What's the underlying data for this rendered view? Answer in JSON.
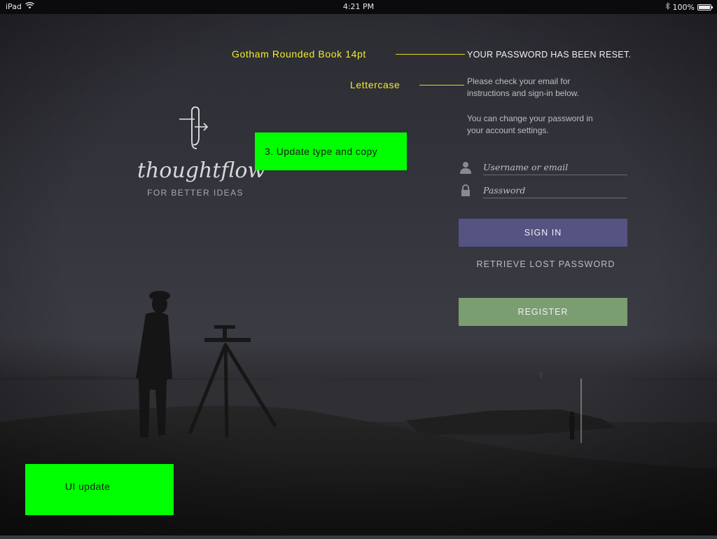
{
  "status_bar": {
    "device": "iPad",
    "time": "4:21 PM",
    "battery": "100%"
  },
  "logo": {
    "wordmark": "thoughtflow",
    "tagline": "FOR BETTER IDEAS"
  },
  "annotations": {
    "font_note": "Gotham Rounded Book 14pt",
    "case_note": "Lettercase",
    "step_note": "3. Update type and copy",
    "ui_note": "UI update"
  },
  "reset": {
    "headline": "YOUR PASSWORD HAS BEEN RESET.",
    "message_1_line_1": "Please check your email for",
    "message_1_line_2": "instructions and sign-in below.",
    "message_2_line_1": "You can change your password in",
    "message_2_line_2": "your account settings."
  },
  "form": {
    "username_placeholder": "Username or email",
    "password_placeholder": "Password",
    "sign_in_label": "SIGN IN",
    "retrieve_label": "RETRIEVE LOST PASSWORD",
    "register_label": "REGISTER"
  },
  "colors": {
    "annotation": "#f2ec2c",
    "highlight_green": "#00ff00",
    "sign_in": "#545382",
    "register": "#7a9e71"
  }
}
